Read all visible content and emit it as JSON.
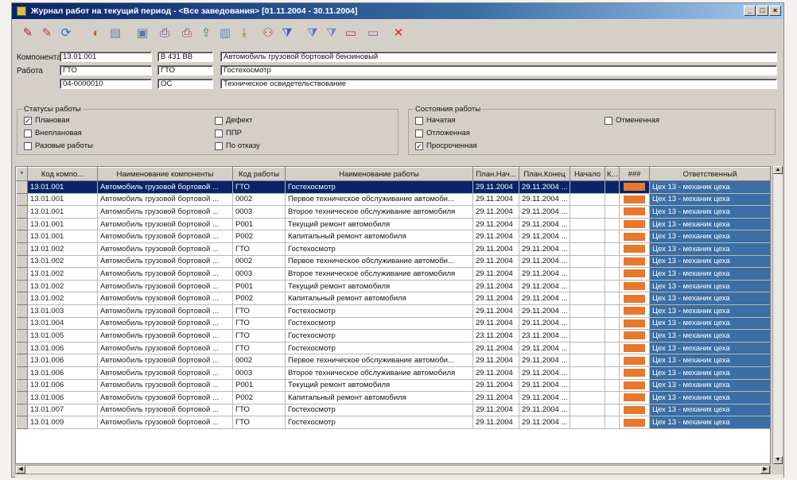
{
  "window": {
    "title": "Журнал работ на текущий период - <Все заведования> [01.11.2004 - 30.11.2004]",
    "controls": [
      "_",
      "□",
      "×"
    ]
  },
  "toolbar": {
    "buttons": [
      {
        "icon": "add-red-icon",
        "glyph": "✎",
        "color": "#c02020"
      },
      {
        "icon": "add-red-alt-icon",
        "glyph": "✎",
        "color": "#c04040"
      },
      {
        "icon": "refresh-icon",
        "glyph": "⟳",
        "color": "#2a6ac8"
      },
      {
        "icon": "color-icon",
        "glyph": "◐",
        "color": "#c85a20"
      },
      {
        "icon": "grid-icon",
        "glyph": "▤",
        "color": "#6a7aa0"
      },
      {
        "icon": "screen-icon",
        "glyph": "▣",
        "color": "#5a7aa0"
      },
      {
        "icon": "print-icon",
        "glyph": "⎙",
        "color": "#6a3a8a"
      },
      {
        "icon": "print-preview-icon",
        "glyph": "⎙",
        "color": "#8a3a6a"
      },
      {
        "icon": "export-icon",
        "glyph": "⇪",
        "color": "#3a8a5a"
      },
      {
        "icon": "chart-icon",
        "glyph": "▥",
        "color": "#5a8ac0"
      },
      {
        "icon": "import-icon",
        "glyph": "⤓",
        "color": "#a07020"
      },
      {
        "icon": "users-icon",
        "glyph": "⚇",
        "color": "#a05a20"
      },
      {
        "icon": "filter-icon",
        "glyph": "⧩",
        "color": "#3a5ac8"
      },
      {
        "icon": "filter-add-icon",
        "glyph": "⧩",
        "color": "#5a7ac8"
      },
      {
        "icon": "filter-remove-icon",
        "glyph": "⧩",
        "color": "#7a8ac8"
      },
      {
        "icon": "form-icon",
        "glyph": "▭",
        "color": "#9a3a6a"
      },
      {
        "icon": "form-alt-icon",
        "glyph": "▭",
        "color": "#9a5a8a"
      },
      {
        "icon": "close-icon",
        "glyph": "✕",
        "color": "#e02020"
      }
    ]
  },
  "fields": {
    "component_label": "Компонента",
    "component_code": "13.01.001",
    "component_reg": "В 431 ВВ",
    "component_name": "Автомобиль грузовой бортовой бензиновый",
    "work_label": "Работа",
    "work_code": "ГТО",
    "work_short": "ГТО",
    "work_name": "Гостехосмотр",
    "doc_number": "04-0000010",
    "doc_short": "ОС",
    "doc_name": "Техническое освидетельствование"
  },
  "statuses": {
    "title": "Статусы работы",
    "items": [
      {
        "label": "Плановая",
        "checked": true
      },
      {
        "label": "Внеплановая",
        "checked": false
      },
      {
        "label": "Разовые работы",
        "checked": false
      },
      {
        "label": "Дефект",
        "checked": false
      },
      {
        "label": "ППР",
        "checked": false
      },
      {
        "label": "По отказу",
        "checked": false
      }
    ]
  },
  "states": {
    "title": "Состояния работы",
    "items": [
      {
        "label": "Начатая",
        "checked": false
      },
      {
        "label": "Отложенная",
        "checked": false
      },
      {
        "label": "Просроченная",
        "checked": true
      },
      {
        "label": "Отмененная",
        "checked": false
      }
    ]
  },
  "table": {
    "columns": [
      "*",
      "Код компо...",
      "Наименование компоненты",
      "Код работы",
      "Наименование работы",
      "План.Нач...",
      "План.Конец",
      "Начало",
      "К...",
      "###",
      "Ответственный"
    ],
    "status_color": "#e8782c",
    "selected_color": "#0a246a",
    "rows": [
      {
        "code": "13.01.001",
        "name": "Автомобиль грузовой бортовой ...",
        "work_code": "ГТО",
        "work_name": "Гостехосмотр",
        "plan_start": "29.11.2004",
        "plan_end": "29.11.2004 ...",
        "start": "",
        "k": "",
        "resp": "Цех 13 - механик цеха",
        "selected": true
      },
      {
        "code": "13.01.001",
        "name": "Автомобиль грузовой бортовой ...",
        "work_code": "0002",
        "work_name": "Первое техническое обслуживание автомоби...",
        "plan_start": "29.11.2004",
        "plan_end": "29.11.2004 ...",
        "start": "",
        "k": "",
        "resp": "Цех 13 - механик цеха",
        "selected": false
      },
      {
        "code": "13.01.001",
        "name": "Автомобиль грузовой бортовой ...",
        "work_code": "0003",
        "work_name": "Второе техническое обслуживание автомобиля",
        "plan_start": "29.11.2004",
        "plan_end": "29.11.2004 ...",
        "start": "",
        "k": "",
        "resp": "Цех 13 - механик цеха",
        "selected": false
      },
      {
        "code": "13.01.001",
        "name": "Автомобиль грузовой бортовой ...",
        "work_code": "Р001",
        "work_name": "Текущий ремонт автомобиля",
        "plan_start": "29.11.2004",
        "plan_end": "29.11.2004 ...",
        "start": "",
        "k": "",
        "resp": "Цех 13 - механик цеха",
        "selected": false
      },
      {
        "code": "13.01.001",
        "name": "Автомобиль грузовой бортовой ...",
        "work_code": "Р002",
        "work_name": "Капитальный ремонт автомобиля",
        "plan_start": "29.11.2004",
        "plan_end": "29.11.2004 ...",
        "start": "",
        "k": "",
        "resp": "Цех 13 - механик цеха",
        "selected": false
      },
      {
        "code": "13.01.002",
        "name": "Автомобиль грузовой бортовой ...",
        "work_code": "ГТО",
        "work_name": "Гостехосмотр",
        "plan_start": "29.11.2004",
        "plan_end": "29.11.2004 ...",
        "start": "",
        "k": "",
        "resp": "Цех 13 - механик цеха",
        "selected": false
      },
      {
        "code": "13.01.002",
        "name": "Автомобиль грузовой бортовой ...",
        "work_code": "0002",
        "work_name": "Первое техническое обслуживание автомоби...",
        "plan_start": "29.11.2004",
        "plan_end": "29.11.2004 ...",
        "start": "",
        "k": "",
        "resp": "Цех 13 - механик цеха",
        "selected": false
      },
      {
        "code": "13.01.002",
        "name": "Автомобиль грузовой бортовой ...",
        "work_code": "0003",
        "work_name": "Второе техническое обслуживание автомобиля",
        "plan_start": "29.11.2004",
        "plan_end": "29.11.2004 ...",
        "start": "",
        "k": "",
        "resp": "Цех 13 - механик цеха",
        "selected": false
      },
      {
        "code": "13.01.002",
        "name": "Автомобиль грузовой бортовой ...",
        "work_code": "Р001",
        "work_name": "Текущий ремонт автомобиля",
        "plan_start": "29.11.2004",
        "plan_end": "29.11.2004 ...",
        "start": "",
        "k": "",
        "resp": "Цех 13 - механик цеха",
        "selected": false
      },
      {
        "code": "13.01.002",
        "name": "Автомобиль грузовой бортовой ...",
        "work_code": "Р002",
        "work_name": "Капитальный ремонт автомобиля",
        "plan_start": "29.11.2004",
        "plan_end": "29.11.2004 ...",
        "start": "",
        "k": "",
        "resp": "Цех 13 - механик цеха",
        "selected": false
      },
      {
        "code": "13.01.003",
        "name": "Автомобиль грузовой бортовой ...",
        "work_code": "ГТО",
        "work_name": "Гостехосмотр",
        "plan_start": "29.11.2004",
        "plan_end": "29.11.2004 ...",
        "start": "",
        "k": "",
        "resp": "Цех 13 - механик цеха",
        "selected": false
      },
      {
        "code": "13.01.004",
        "name": "Автомобиль грузовой бортовой ...",
        "work_code": "ГТО",
        "work_name": "Гостехосмотр",
        "plan_start": "29.11.2004",
        "plan_end": "29.11.2004 ...",
        "start": "",
        "k": "",
        "resp": "Цех 13 - механик цеха",
        "selected": false
      },
      {
        "code": "13.01.005",
        "name": "Автомобиль грузовой бортовой ...",
        "work_code": "ГТО",
        "work_name": "Гостехосмотр",
        "plan_start": "23.11.2004",
        "plan_end": "23.11.2004 ...",
        "start": "",
        "k": "",
        "resp": "Цех 13 - механик цеха",
        "selected": false
      },
      {
        "code": "13.01.006",
        "name": "Автомобиль грузовой бортовой ...",
        "work_code": "ГТО",
        "work_name": "Гостехосмотр",
        "plan_start": "29.11.2004",
        "plan_end": "29.11.2004 ...",
        "start": "",
        "k": "",
        "resp": "Цех 13 - механик цеха",
        "selected": false
      },
      {
        "code": "13.01.006",
        "name": "Автомобиль грузовой бортовой ...",
        "work_code": "0002",
        "work_name": "Первое техническое обслуживание автомоби...",
        "plan_start": "29.11.2004",
        "plan_end": "29.11.2004 ...",
        "start": "",
        "k": "",
        "resp": "Цех 13 - механик цеха",
        "selected": false
      },
      {
        "code": "13.01.006",
        "name": "Автомобиль грузовой бортовой ...",
        "work_code": "0003",
        "work_name": "Второе техническое обслуживание автомобиля",
        "plan_start": "29.11.2004",
        "plan_end": "29.11.2004 ...",
        "start": "",
        "k": "",
        "resp": "Цех 13 - механик цеха",
        "selected": false
      },
      {
        "code": "13.01.006",
        "name": "Автомобиль грузовой бортовой ...",
        "work_code": "Р001",
        "work_name": "Текущий ремонт автомобиля",
        "plan_start": "29.11.2004",
        "plan_end": "29.11.2004 ...",
        "start": "",
        "k": "",
        "resp": "Цех 13 - механик цеха",
        "selected": false
      },
      {
        "code": "13.01.006",
        "name": "Автомобиль грузовой бортовой ...",
        "work_code": "Р002",
        "work_name": "Капитальный ремонт автомобиля",
        "plan_start": "29.11.2004",
        "plan_end": "29.11.2004 ...",
        "start": "",
        "k": "",
        "resp": "Цех 13 - механик цеха",
        "selected": false
      },
      {
        "code": "13.01.007",
        "name": "Автомобиль грузовой бортовой ...",
        "work_code": "ГТО",
        "work_name": "Гостехосмотр",
        "plan_start": "29.11.2004",
        "plan_end": "29.11.2004 ...",
        "start": "",
        "k": "",
        "resp": "Цех 13 - механик цеха",
        "selected": false
      },
      {
        "code": "13.01.009",
        "name": "Автомобиль грузовой бортовой ...",
        "work_code": "ГТО",
        "work_name": "Гостехосмотр",
        "plan_start": "29.11.2004",
        "plan_end": "29.11.2004 ...",
        "start": "",
        "k": "",
        "resp": "Цех 13 - механик цеха",
        "selected": false
      }
    ]
  },
  "scroll": {
    "left_arrow": "◀",
    "right_arrow": "▶",
    "up_arrow": "▲",
    "down_arrow": "▼"
  }
}
